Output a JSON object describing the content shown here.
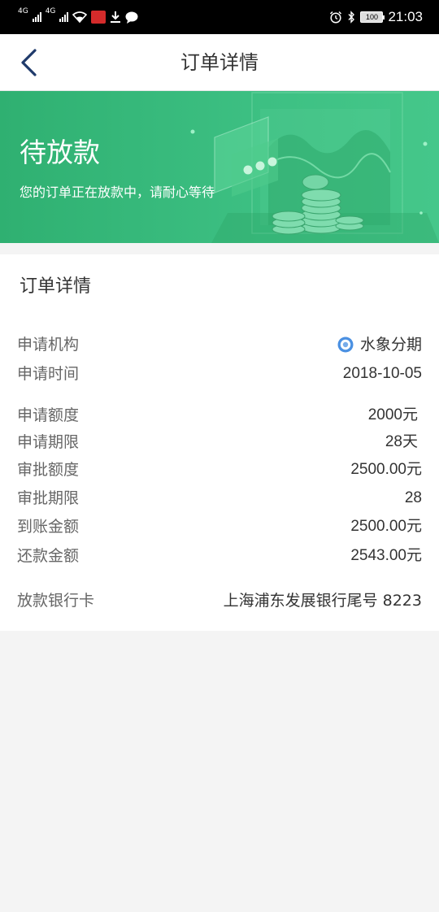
{
  "status_bar": {
    "network_1": "4G",
    "network_2": "4G",
    "time": "21:03",
    "battery": "100"
  },
  "nav": {
    "title": "订单详情",
    "back_icon": "chevron-left-icon"
  },
  "banner": {
    "status": "待放款",
    "description": "您的订单正在放款中，请耐心等待"
  },
  "detail": {
    "section_title": "订单详情",
    "rows": [
      {
        "label": "申请机构",
        "value": "水象分期"
      },
      {
        "label": "申请时间",
        "value": "2018-10-05"
      },
      {
        "label": "申请额度",
        "value": "2000元"
      },
      {
        "label": "申请期限",
        "value": "28天"
      },
      {
        "label": "审批额度",
        "value": "2500.00元"
      },
      {
        "label": "审批期限",
        "value": "28"
      },
      {
        "label": "到账金额",
        "value": "2500.00元"
      },
      {
        "label": "还款金额",
        "value": "2543.00元"
      },
      {
        "label": "放款银行卡",
        "value": "上海浦东发展银行尾号 8223"
      }
    ]
  },
  "colors": {
    "banner_green": "#3dc083",
    "accent_blue": "#4a90e2",
    "nav_icon": "#1f3a6b"
  }
}
